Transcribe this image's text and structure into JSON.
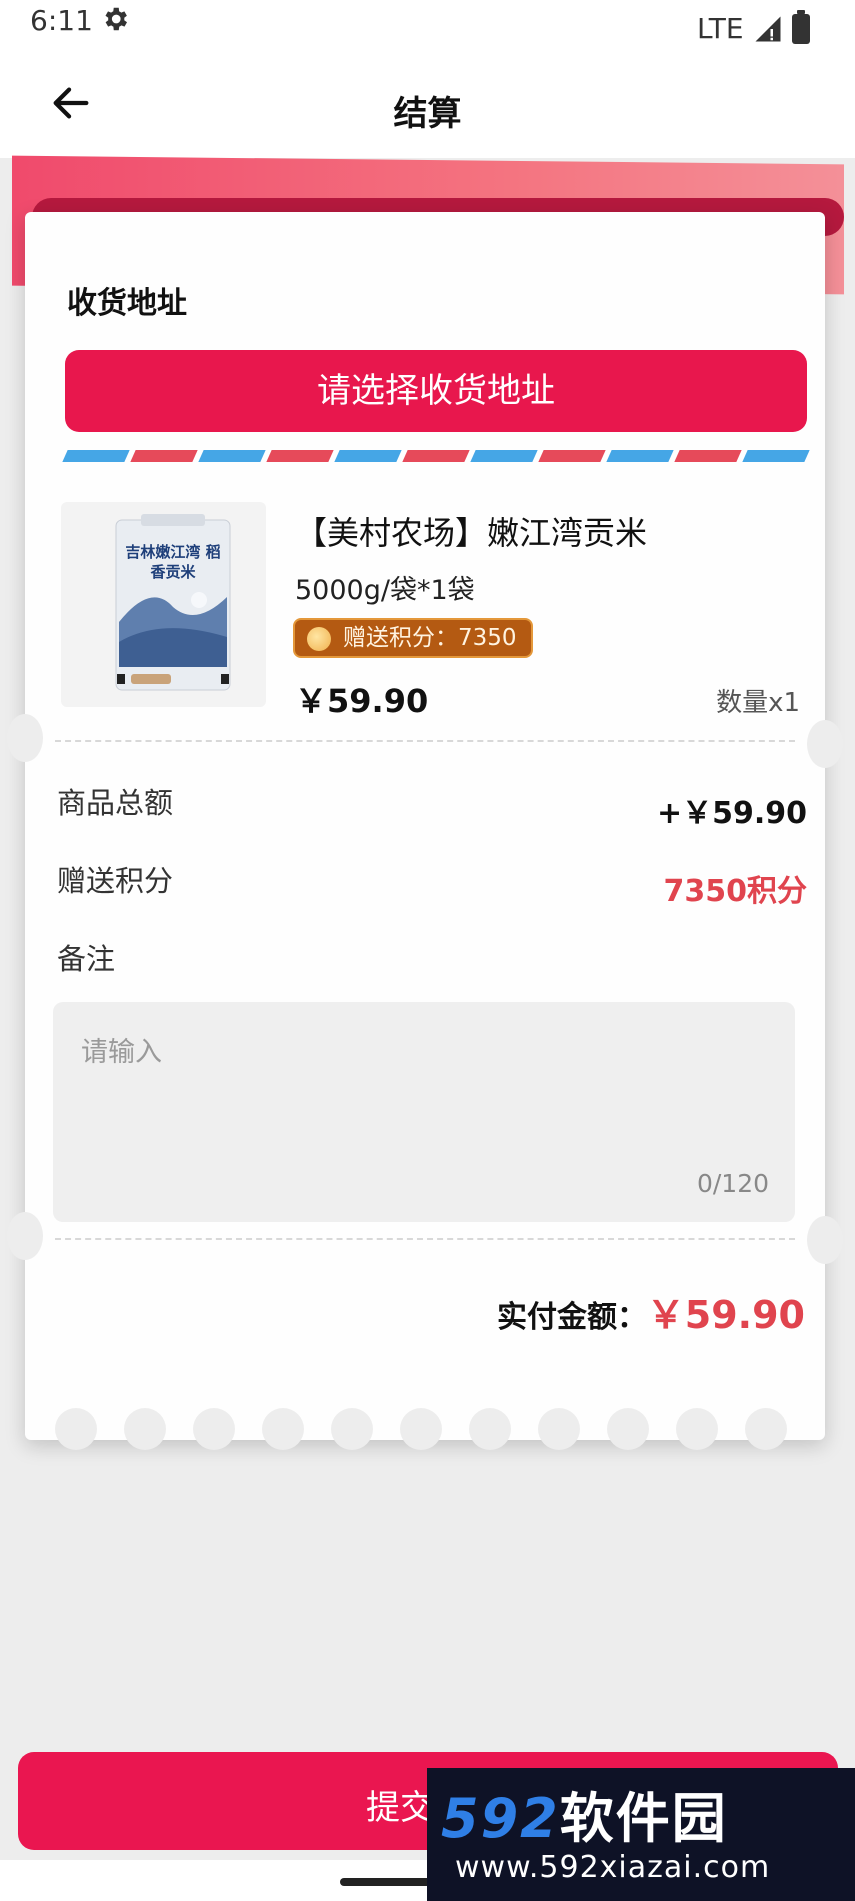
{
  "status_bar": {
    "time": "6:11",
    "network": "LTE"
  },
  "appbar": {
    "title": "结算"
  },
  "address": {
    "section_label": "收货地址",
    "select_button": "请选择收货地址"
  },
  "product": {
    "name": "【美村农场】嫩江湾贡米",
    "spec": "5000g/袋*1袋",
    "points_badge": "赠送积分：7350",
    "price": "￥59.90",
    "quantity": "数量x1",
    "image_label": "吉林嫩江湾 稻香贡米"
  },
  "summary": {
    "rows": [
      {
        "label": "商品总额",
        "value": "+￥59.90"
      },
      {
        "label": "赠送积分",
        "value": "7350积分"
      }
    ],
    "note_label": "备注",
    "note_placeholder": "请输入",
    "note_count": "0/120",
    "total_label": "实付金额：",
    "total_value": "￥59.90"
  },
  "footer": {
    "submit_label": "提交订单"
  },
  "watermark": {
    "brand_digits": "592",
    "brand_cn": "软件园",
    "url": "www.592xiazai.com"
  },
  "colors": {
    "accent": "#e8174d",
    "price_red": "#e0444e",
    "badge": "#b45a12"
  }
}
